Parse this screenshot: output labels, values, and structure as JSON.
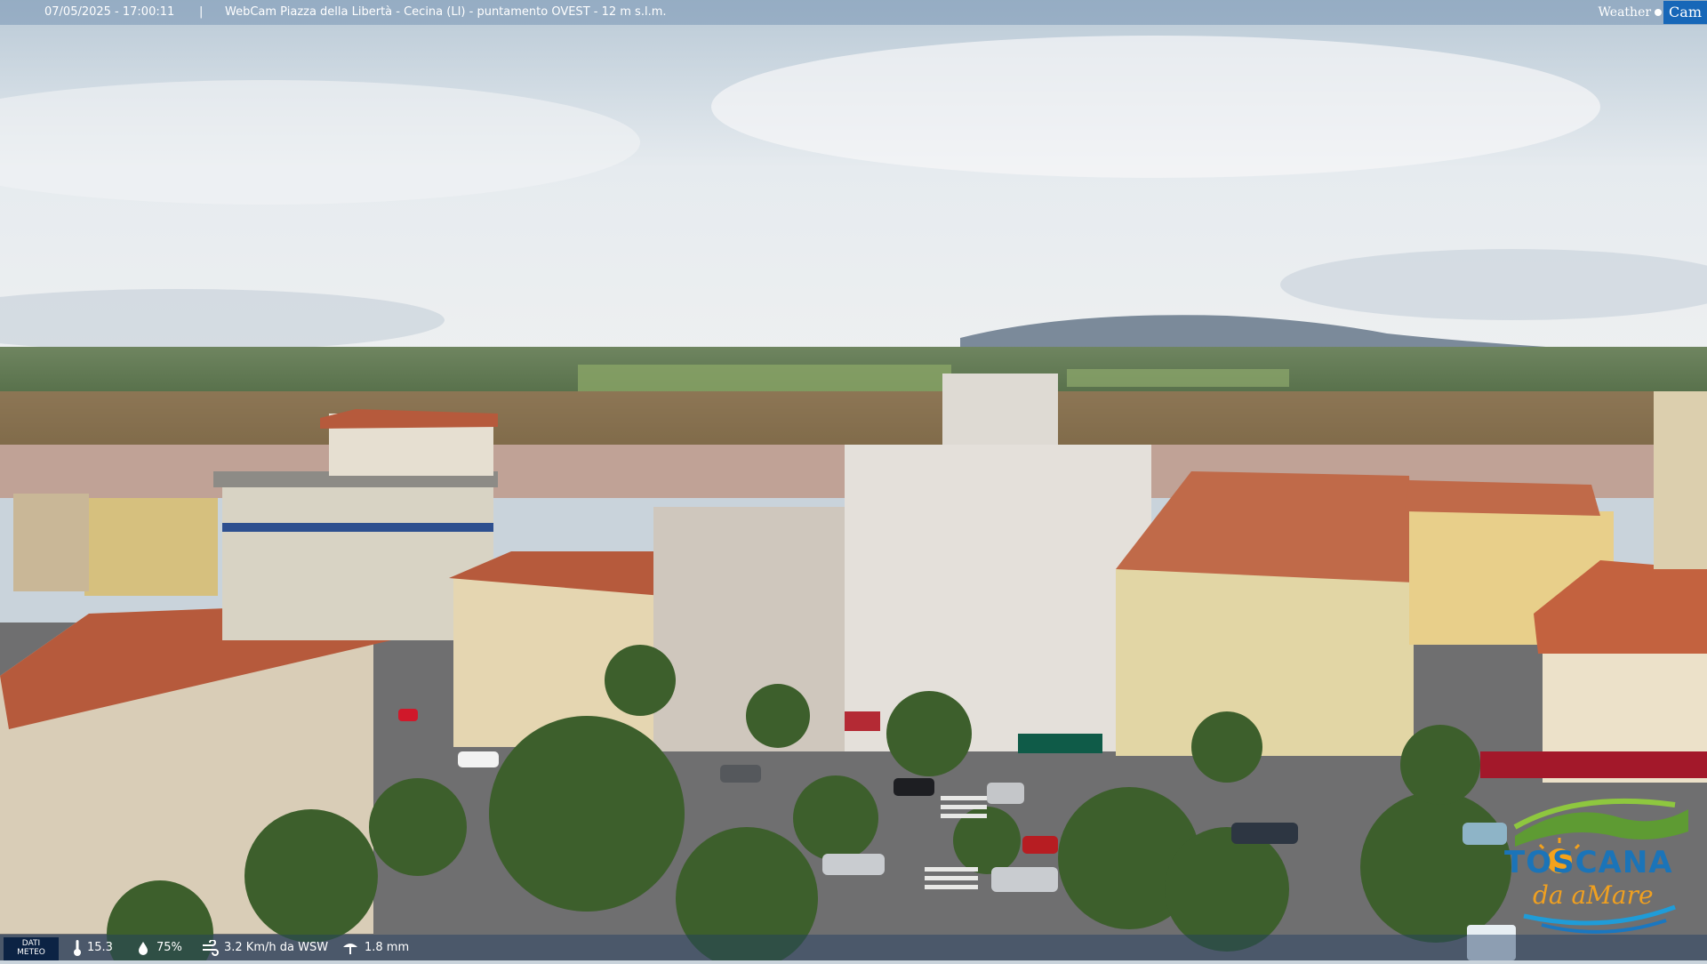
{
  "header": {
    "datetime": "07/05/2025 - 17:00:11",
    "separator": "|",
    "title": "WebCam Piazza della Libertà - Cecina (LI) - puntamento OVEST - 12 m s.l.m.",
    "brand_weather": "Weather",
    "brand_cam": "Cam"
  },
  "weather_bar": {
    "label_line1": "DATI",
    "label_line2": "METEO",
    "temperature": "15.3",
    "humidity": "75%",
    "wind": "3.2 Km/h da WSW",
    "rain": "1.8 mm",
    "icons": [
      "thermometer-icon",
      "humidity-drop-icon",
      "wind-icon",
      "rain-gauge-icon"
    ]
  },
  "logo": {
    "line1": "TOSCANA",
    "line2": "da aMare"
  },
  "colors": {
    "roof": "#b9573b",
    "sky": "#dfe6ec",
    "brand_blue": "#1767b8"
  }
}
